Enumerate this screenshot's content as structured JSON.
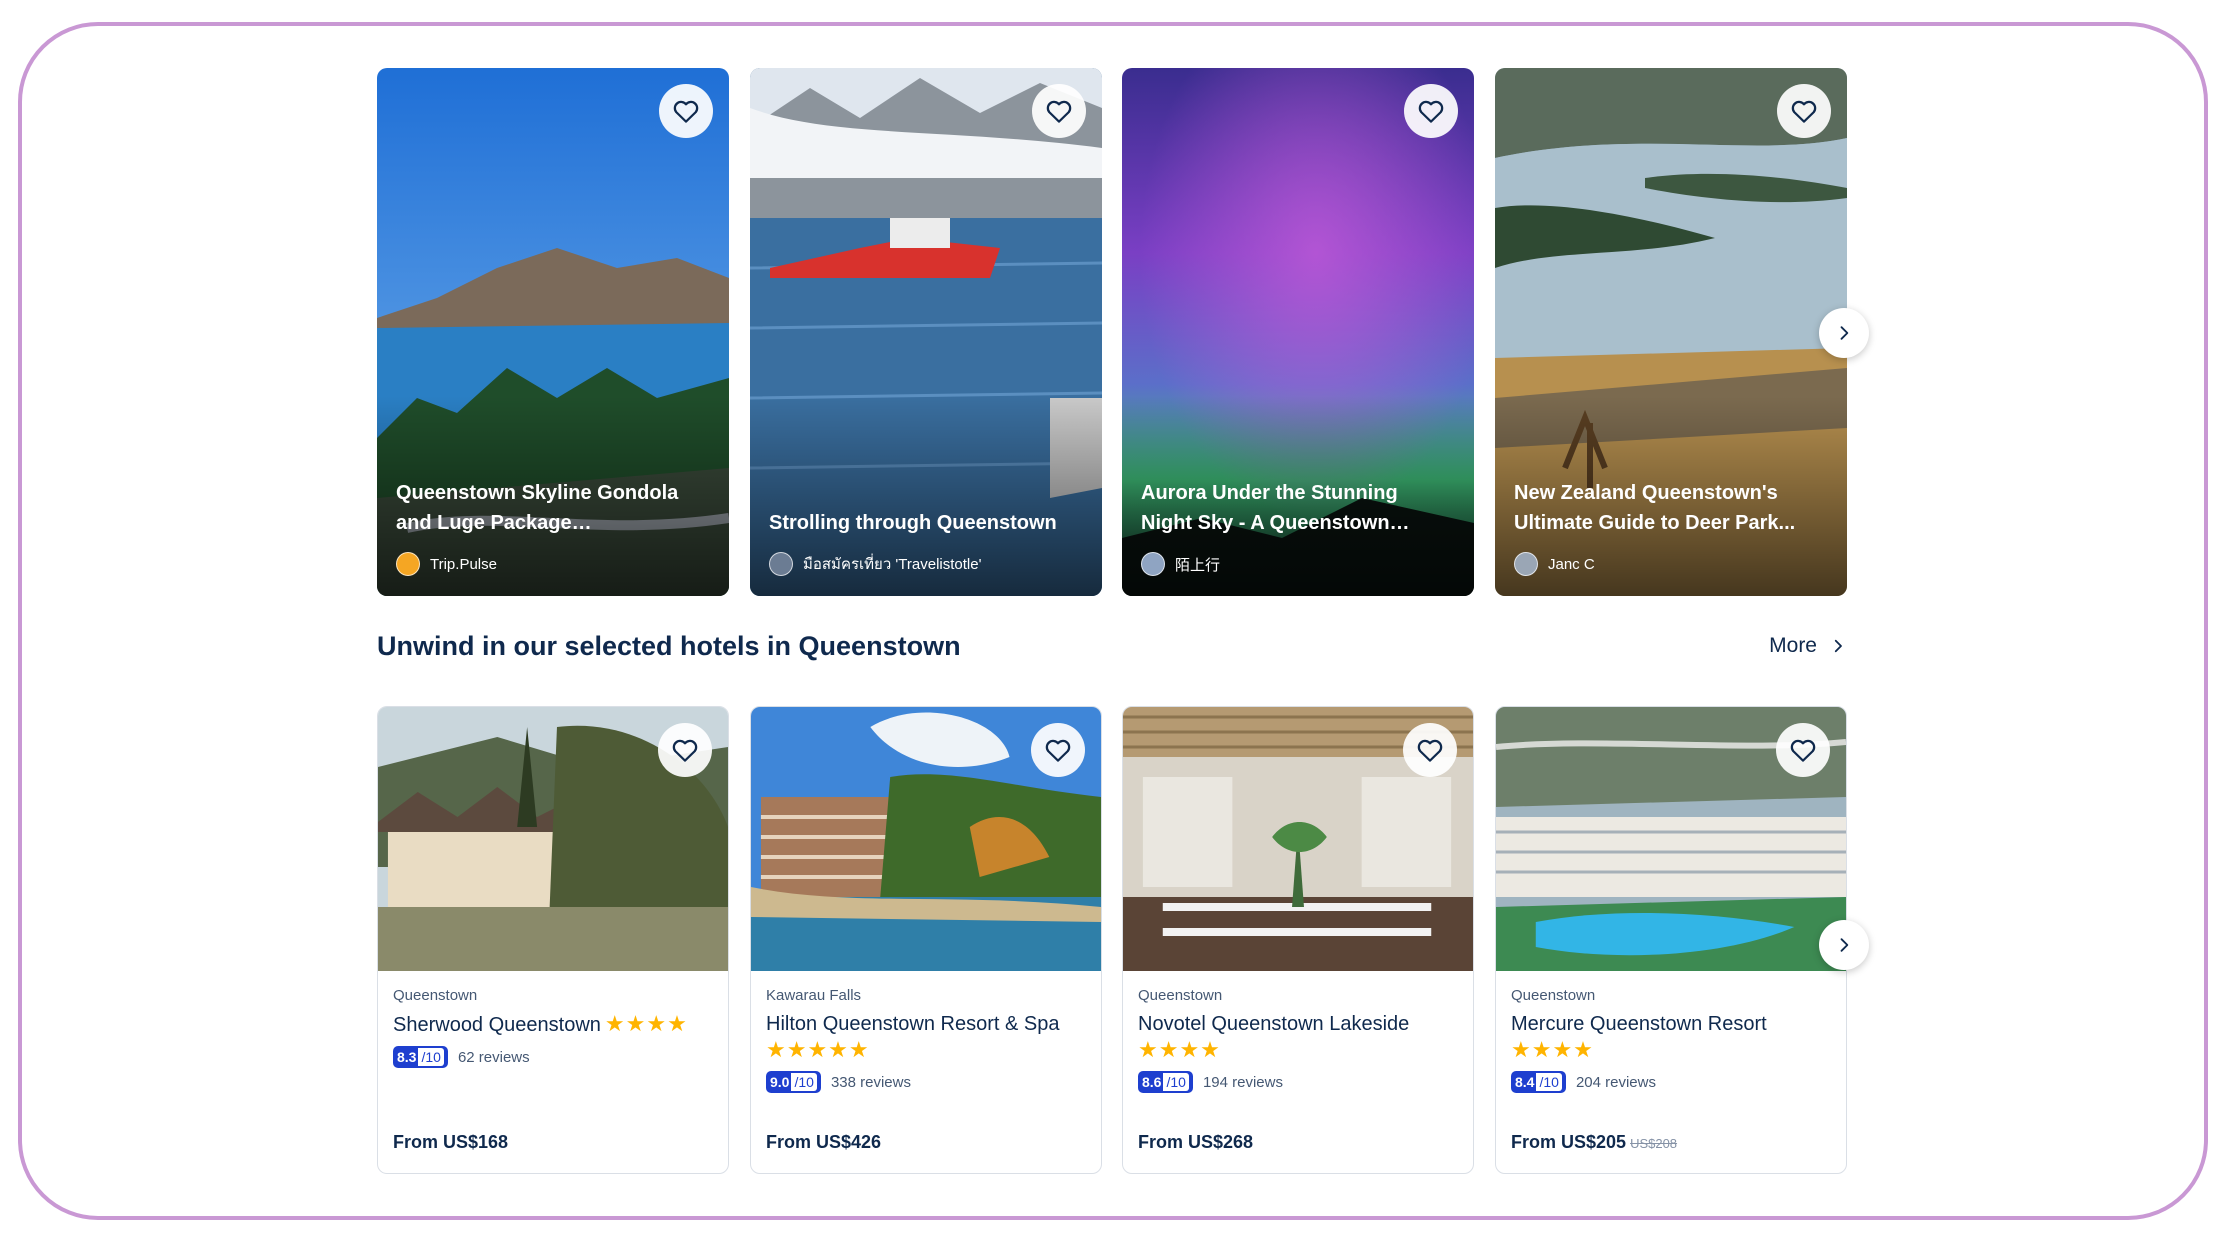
{
  "stories": [
    {
      "title": "Queenstown Skyline Gondola and Luge Package Recommendation",
      "author": "Trip.Pulse",
      "avatar_color": "#f5a623"
    },
    {
      "title": "Strolling through Queenstown",
      "author": "มือสมัครเที่ยว 'Travelistotle'",
      "avatar_color": "#6b7c93"
    },
    {
      "title": "Aurora Under the Stunning Night Sky - A Queenstown Encounter",
      "author": "陌上行",
      "avatar_color": "#8fa4c2"
    },
    {
      "title": "New Zealand Queenstown's Ultimate Guide to Deer Park...",
      "author": "Janc C",
      "avatar_color": "#9aa6b5"
    }
  ],
  "hotels_section": {
    "title": "Unwind in our selected hotels in Queenstown",
    "more_label": "More"
  },
  "hotels": [
    {
      "location": "Queenstown",
      "name": "Sherwood Queenstown",
      "stars": "★★★★",
      "score": "8.3",
      "denom": "/10",
      "reviews": "62 reviews",
      "price": "From US$168",
      "old_price": ""
    },
    {
      "location": "Kawarau Falls",
      "name": "Hilton Queenstown Resort & Spa",
      "stars": "★★★★★",
      "score": "9.0",
      "denom": "/10",
      "reviews": "338 reviews",
      "price": "From US$426",
      "old_price": ""
    },
    {
      "location": "Queenstown",
      "name": "Novotel Queenstown Lakeside",
      "stars": "★★★★",
      "score": "8.6",
      "denom": "/10",
      "reviews": "194 reviews",
      "price": "From US$268",
      "old_price": ""
    },
    {
      "location": "Queenstown",
      "name": "Mercure Queenstown Resort",
      "stars": "★★★★",
      "score": "8.4",
      "denom": "/10",
      "reviews": "204 reviews",
      "price": "From US$205",
      "old_price": "US$208"
    }
  ],
  "icons": {
    "favorite": "heart-icon",
    "next": "chevron-right-icon"
  },
  "colors": {
    "frame": "#c998d4",
    "score_badge": "#1e3fcf",
    "star": "#ffb400",
    "text": "#0f294d"
  }
}
